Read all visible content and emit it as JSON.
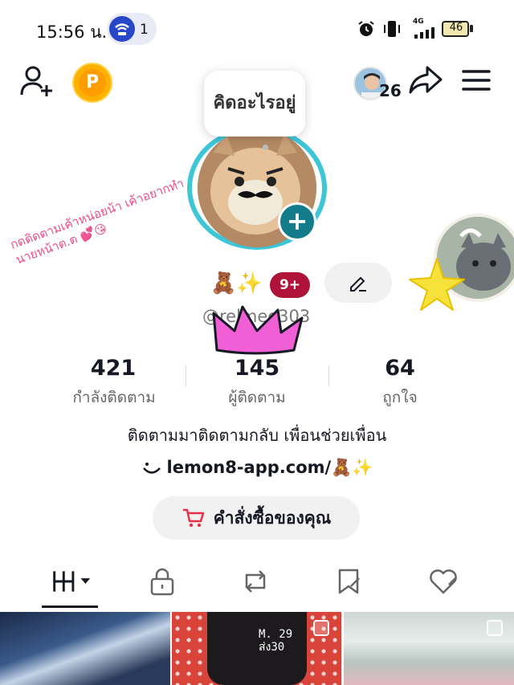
{
  "status_bar": {
    "time": "15:56 น.",
    "notification_count": "1",
    "network_label": "4G",
    "battery": "46"
  },
  "header": {
    "coin_label": "P",
    "visitor_count": "26"
  },
  "note_bubble": {
    "text": "คิดอะไรอยู่"
  },
  "profile": {
    "emoji_badges": "🧸✨",
    "notif_badge": "9+",
    "handle": "@relmeo303"
  },
  "sticker_text": "กดติดตามเค้าหน่อยน้า เค้าอยากทำนายหน้าต.ต 💕😘",
  "stats": [
    {
      "value": "421",
      "label": "กำลังติดตาม"
    },
    {
      "value": "145",
      "label": "ผู้ติดตาม"
    },
    {
      "value": "64",
      "label": "ถูกใจ"
    }
  ],
  "bio": "ติดตามมาติดตามกลับ  เพื่อนช่วยเพื่อน",
  "link": "lemon8-app.com/🧸✨",
  "orders_button": "คำสั่งซื้อของคุณ",
  "thumb2_note": "M. 29\nส่ง30",
  "colors": {
    "accent_teal": "#127c8a",
    "badge_red": "#b0133a",
    "coin_orange": "#ff9c00",
    "ring_cyan": "#3ec6d8"
  },
  "icons": [
    "add-user-icon",
    "coin-icon",
    "share-icon",
    "menu-icon",
    "edit-pencil-icon",
    "cart-icon",
    "grid-posts-icon",
    "lock-icon",
    "repost-icon",
    "bookmark-icon",
    "liked-icon"
  ]
}
